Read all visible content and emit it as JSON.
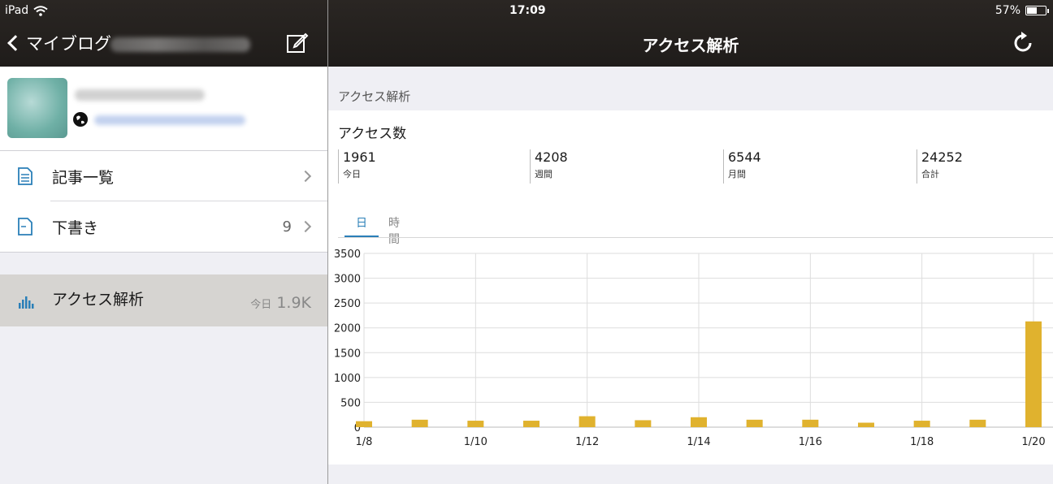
{
  "status_bar": {
    "carrier": "iPad",
    "time": "17:09",
    "battery_percent": "57%",
    "battery_level": 0.57
  },
  "nav_left": {
    "back_label": "マイブログ"
  },
  "nav_right": {
    "title": "アクセス解析"
  },
  "sidebar": {
    "menu": [
      {
        "label": "記事一覧",
        "count": ""
      },
      {
        "label": "下書き",
        "count": "9"
      }
    ],
    "access": {
      "label": "アクセス解析",
      "today_label": "今日",
      "today_value": "1.9K"
    }
  },
  "main": {
    "section_header": "アクセス解析",
    "card_title": "アクセス数",
    "stats": [
      {
        "value": "1961",
        "label": "今日"
      },
      {
        "value": "4208",
        "label": "週間"
      },
      {
        "value": "6544",
        "label": "月間"
      },
      {
        "value": "24252",
        "label": "合計"
      }
    ],
    "tabs": [
      {
        "label": "日",
        "active": true
      },
      {
        "label": "時間",
        "active": false
      }
    ]
  },
  "colors": {
    "accent": "#2a7fb8",
    "bar": "#e0b22e",
    "topbar": "#22201e",
    "active_row": "#d6d4d1"
  },
  "icons": {
    "wifi": "wifi-icon",
    "compose": "compose-icon",
    "refresh": "refresh-icon",
    "articles": "document-list-icon",
    "drafts": "document-icon",
    "access": "bar-chart-icon",
    "globe": "globe-icon"
  },
  "chart_data": {
    "type": "bar",
    "x": [
      "1/8",
      "1/9",
      "1/10",
      "1/11",
      "1/12",
      "1/13",
      "1/14",
      "1/15",
      "1/16",
      "1/17",
      "1/18",
      "1/19",
      "1/20"
    ],
    "x_tick_labels": [
      "1/8",
      "1/10",
      "1/12",
      "1/14",
      "1/16",
      "1/18",
      "1/20"
    ],
    "values": [
      120,
      150,
      130,
      130,
      220,
      140,
      200,
      150,
      150,
      90,
      130,
      150,
      2130
    ],
    "ylim": [
      0,
      3500
    ],
    "y_ticks": [
      0,
      500,
      1000,
      1500,
      2000,
      2500,
      3000,
      3500
    ],
    "grid": true,
    "bar_color": "#e0b22e"
  }
}
